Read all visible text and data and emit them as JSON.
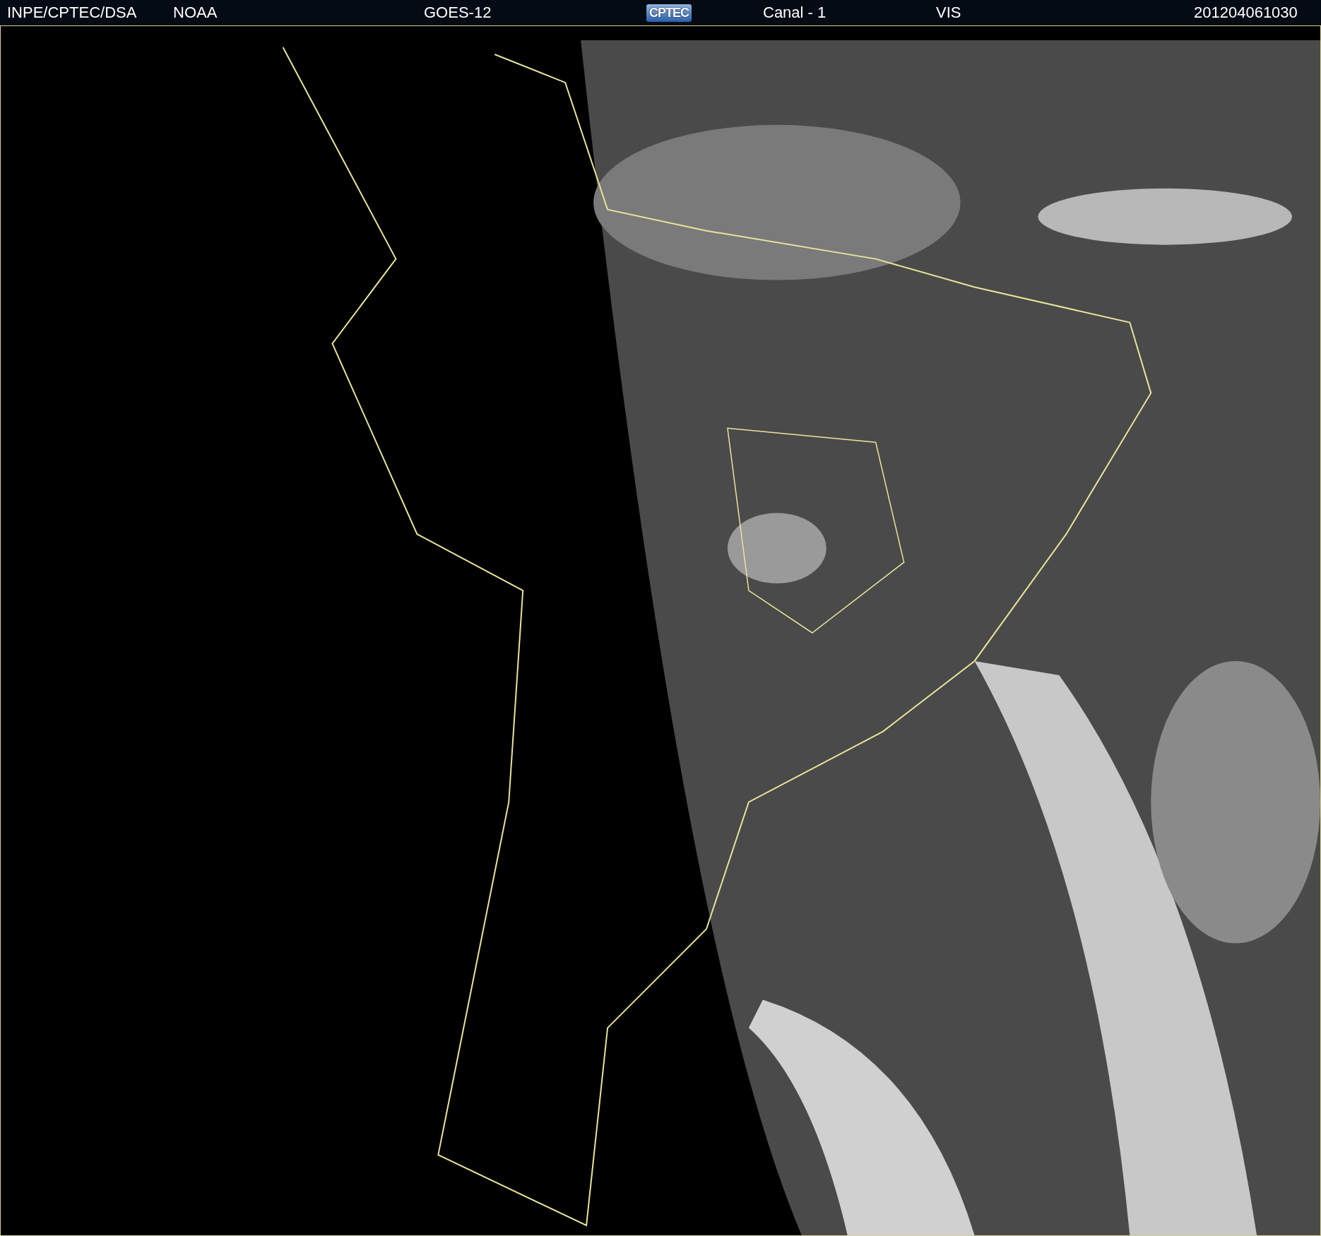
{
  "header": {
    "items": [
      {
        "kind": "text",
        "text": "INPE/CPTEC/DSA"
      },
      {
        "kind": "text",
        "text": "NOAA"
      },
      {
        "kind": "text",
        "text": "GOES-12"
      },
      {
        "kind": "logo",
        "text": "CPTEC"
      },
      {
        "kind": "text",
        "text": "Canal - 1"
      },
      {
        "kind": "text",
        "text": "VIS"
      },
      {
        "kind": "text",
        "text": "201204061030"
      }
    ]
  }
}
